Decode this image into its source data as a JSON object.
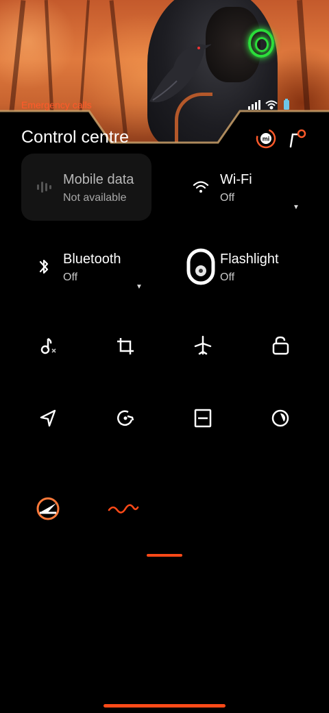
{
  "status_bar": {
    "left_text": "Emergency calls",
    "icons": [
      "signal-icon",
      "wifi-icon",
      "battery-icon"
    ]
  },
  "header": {
    "title": "Control centre",
    "icons": [
      "mi-account-icon",
      "edit-icon"
    ]
  },
  "tiles": [
    {
      "name": "Mobile data",
      "status": "Not available",
      "icon": "mobile-data-icon",
      "active": false
    },
    {
      "name": "Wi-Fi",
      "status": "Off",
      "icon": "wifi-icon",
      "active": false
    },
    {
      "name": "Bluetooth",
      "status": "Off",
      "icon": "bluetooth-icon",
      "active": false
    },
    {
      "name": "Flashlight",
      "status": "Off",
      "icon": "flashlight-icon",
      "active": false
    }
  ],
  "toggles": [
    "mute-icon",
    "screenshot-icon",
    "airplane-mode-icon",
    "lock-screen-icon",
    "location-icon",
    "auto-rotate-icon",
    "reading-mode-icon",
    "dark-mode-icon",
    "game-turbo-icon",
    "sound-wave-icon"
  ],
  "colors": {
    "accent": "#ff4a18",
    "tile_background": "#141414",
    "background": "#000000",
    "wallpaper_glow": "#2bdc3a"
  }
}
